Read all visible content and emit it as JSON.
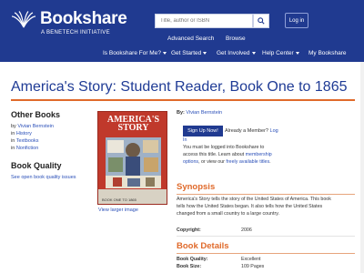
{
  "header": {
    "logo": {
      "title": "Bookshare",
      "subtitle": "A BENETECH INITIATIVE"
    },
    "search": {
      "placeholder": "Title, author or ISBN"
    },
    "login_label": "Log in",
    "subnav": [
      "Advanced Search",
      "Browse"
    ],
    "nav": [
      {
        "label": "Is Bookshare For Me?",
        "has_caret": true
      },
      {
        "label": "Get Started",
        "has_caret": true
      },
      {
        "label": "Get Involved",
        "has_caret": true
      },
      {
        "label": "Help Center",
        "has_caret": true
      },
      {
        "label": "My Bookshare",
        "has_caret": false
      }
    ],
    "colors": {
      "brand": "#203a90",
      "accent": "#e06a2b",
      "link": "#2a4fb8"
    }
  },
  "page": {
    "title": "America's Story: Student Reader, Book One to 1865"
  },
  "sidebar": {
    "other_books_heading": "Other Books",
    "other_books": [
      {
        "prefix": "by ",
        "link": "Vivian Bernstein"
      },
      {
        "prefix": "in ",
        "link": "History"
      },
      {
        "prefix": "in ",
        "link": "Textbooks"
      },
      {
        "prefix": "in ",
        "link": "Nonfiction"
      }
    ],
    "book_quality_heading": "Book Quality",
    "book_quality_link": "See open book quality issues"
  },
  "cover": {
    "title_line1": "AMERICA'S",
    "title_line2": "STORY",
    "caption": "BOOK ONE TO 1865",
    "view_larger": "View larger image"
  },
  "details": {
    "by_label": "By:",
    "author": "Vivian Bernstein",
    "signup_label": "Sign Up Now!",
    "member_prompt": "Already a Member?",
    "login_link": "Log",
    "login_link2": "In",
    "access_line1": "You must be logged into Bookshare to",
    "access_line2_pre": "access this title. Learn about ",
    "access_line2_link": "membership",
    "access_line3_link": "options",
    "access_line3_mid": ", or view our ",
    "access_line3_link2": "freely available titles",
    "access_line3_end": ".",
    "synopsis_heading": "Synopsis",
    "synopsis_line1": "America's Story tells the story of the United States of America. This book",
    "synopsis_line2": "tells how the United States began. It also tells how the United States",
    "synopsis_line3": "changed from a small country to a large country.",
    "copyright_label": "Copyright:",
    "copyright_value": "2006",
    "book_details_heading": "Book Details",
    "quality_label": "Book Quality:",
    "quality_value": "Excellent",
    "size_label": "Book Size:",
    "size_value": "109 Pages"
  }
}
